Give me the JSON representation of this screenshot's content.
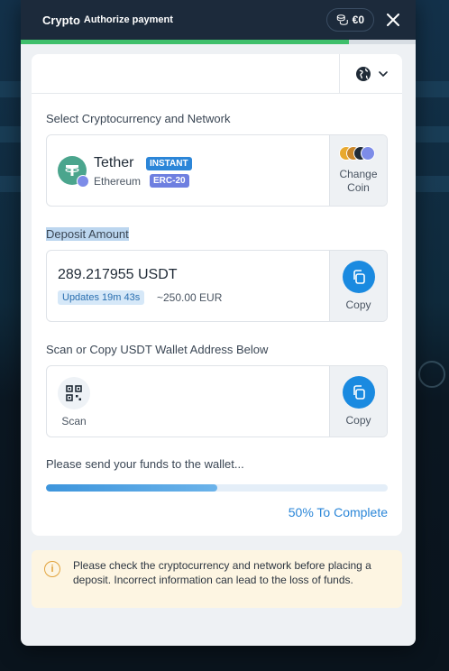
{
  "header": {
    "title": "Crypto",
    "subtitle": "Authorize payment",
    "balance": "€0",
    "top_progress": 0.83
  },
  "select_section": {
    "label": "Select Cryptocurrency and Network",
    "coin_name": "Tether",
    "instant_badge": "INSTANT",
    "network": "Ethereum",
    "network_badge": "ERC-20",
    "change_button": "Change Coin"
  },
  "deposit_section": {
    "label": "Deposit Amount",
    "amount": "289.217955 USDT",
    "updates": "Updates 19m 43s",
    "fiat": "~250.00 EUR",
    "copy_button": "Copy"
  },
  "wallet_section": {
    "label": "Scan or Copy USDT Wallet Address Below",
    "scan_button": "Scan",
    "copy_button": "Copy"
  },
  "progress": {
    "message": "Please send your funds to the wallet...",
    "percent": 50,
    "complete_label": "50% To Complete"
  },
  "warning": {
    "text": "Please check the cryptocurrency and network before placing a deposit. Incorrect information can lead to the loss of funds."
  },
  "colors": {
    "header_bg": "#1c2a3b",
    "accent_blue": "#1a8ae0",
    "tether_green": "#4ba58d",
    "warning_bg": "#fdf5e2"
  }
}
